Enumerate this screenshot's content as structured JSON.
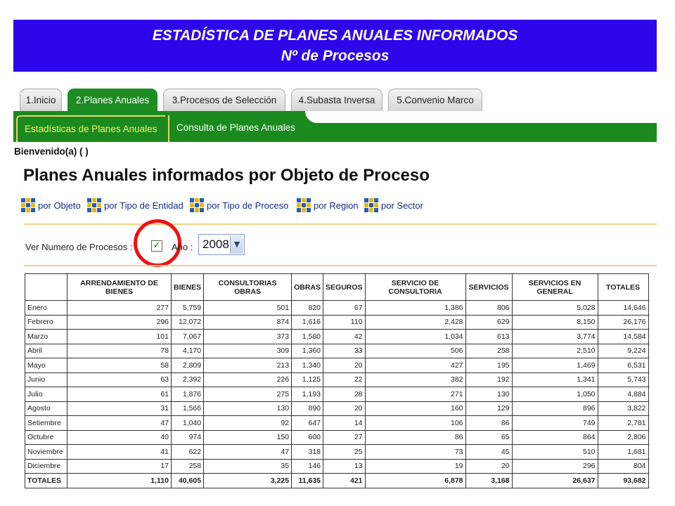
{
  "banner": {
    "line1": "ESTADÍSTICA DE PLANES ANUALES INFORMADOS",
    "line2": "Nº de Procesos"
  },
  "tabs": [
    {
      "label": "1.Inicio"
    },
    {
      "label": "2.Planes Anuales"
    },
    {
      "label": "3.Procesos de Selección"
    },
    {
      "label": "4.Subasta Inversa"
    },
    {
      "label": "5.Convenio Marco"
    }
  ],
  "subtabs": [
    {
      "label": "Estadísticas de Planes Anuales"
    },
    {
      "label": "Consulta de Planes Anuales"
    }
  ],
  "welcome": "Bienvenido(a) ( )",
  "page_title": "Planes Anuales informados por Objeto de Proceso",
  "view_links": [
    {
      "label": "por Objeto",
      "icon": "grid-icon"
    },
    {
      "label": "por Tipo de Entidad",
      "icon": "grid-icon"
    },
    {
      "label": "por Tipo de Proceso",
      "icon": "grid-icon"
    },
    {
      "label": "por Region",
      "icon": "grid-icon"
    },
    {
      "label": "por Sector",
      "icon": "grid-icon"
    }
  ],
  "filters": {
    "ver_numero_label": "Ver Numero de Procesos :",
    "ver_numero_checked": true,
    "anio_label": "Año :",
    "anio_value": "2008"
  },
  "table": {
    "columns": [
      "",
      "ARRENDAMIENTO DE BIENES",
      "BIENES",
      "CONSULTORIAS OBRAS",
      "OBRAS",
      "SEGUROS",
      "SERVICIO DE CONSULTORIA",
      "SERVICIOS",
      "SERVICIOS EN GENERAL",
      "TOTALES"
    ],
    "rows": [
      [
        "Enero",
        "277",
        "5,759",
        "501",
        "820",
        "67",
        "1,386",
        "806",
        "5,028",
        "14,646"
      ],
      [
        "Febrero",
        "296",
        "12,072",
        "874",
        "1,616",
        "110",
        "2,428",
        "629",
        "8,150",
        "26,176"
      ],
      [
        "Marzo",
        "101",
        "7,067",
        "373",
        "1,580",
        "42",
        "1,034",
        "613",
        "3,774",
        "14,584"
      ],
      [
        "Abril",
        "78",
        "4,170",
        "309",
        "1,360",
        "33",
        "506",
        "258",
        "2,510",
        "9,224"
      ],
      [
        "Mayo",
        "58",
        "2,809",
        "213",
        "1,340",
        "20",
        "427",
        "195",
        "1,469",
        "6,531"
      ],
      [
        "Junio",
        "63",
        "2,392",
        "226",
        "1,125",
        "22",
        "382",
        "192",
        "1,341",
        "5,743"
      ],
      [
        "Julio",
        "61",
        "1,876",
        "275",
        "1,193",
        "28",
        "271",
        "130",
        "1,050",
        "4,884"
      ],
      [
        "Agosto",
        "31",
        "1,566",
        "130",
        "890",
        "20",
        "160",
        "129",
        "896",
        "3,822"
      ],
      [
        "Setiembre",
        "47",
        "1,040",
        "92",
        "647",
        "14",
        "106",
        "86",
        "749",
        "2,781"
      ],
      [
        "Octubre",
        "40",
        "974",
        "150",
        "600",
        "27",
        "86",
        "65",
        "864",
        "2,806"
      ],
      [
        "Noviembre",
        "41",
        "622",
        "47",
        "318",
        "25",
        "73",
        "45",
        "510",
        "1,681"
      ],
      [
        "Diciembre",
        "17",
        "258",
        "35",
        "146",
        "13",
        "19",
        "20",
        "296",
        "804"
      ]
    ],
    "totals": [
      "TOTALES",
      "1,110",
      "40,605",
      "3,225",
      "11,635",
      "421",
      "6,878",
      "3,168",
      "26,637",
      "93,682"
    ]
  },
  "colors": {
    "banner": "#2d06ea",
    "green_bar": "#1b8a1e",
    "highlight_circle": "#ee1111"
  }
}
